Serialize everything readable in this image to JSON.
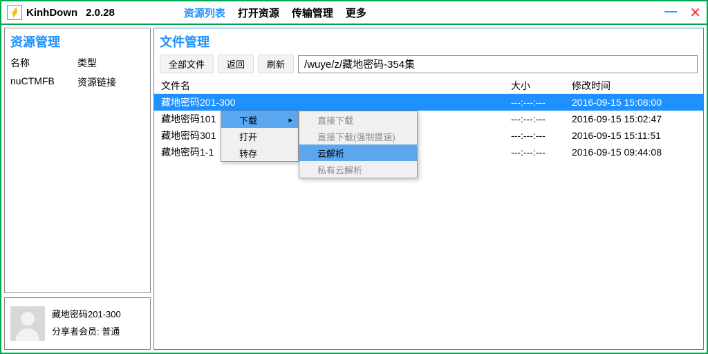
{
  "titlebar": {
    "app": "KinhDown",
    "version": "2.0.28",
    "tabs": {
      "t0": "资源列表",
      "t1": "打开资源",
      "t2": "传输管理",
      "t3": "更多"
    }
  },
  "sidebar": {
    "title": "资源管理",
    "head": {
      "c0": "名称",
      "c1": "类型"
    },
    "rows": [
      {
        "c0": "nuCTMFB",
        "c1": "资源链接"
      }
    ]
  },
  "sharer": {
    "name": "藏地密码201-300",
    "memberLabel": "分享者会员:",
    "memberValue": "普通"
  },
  "main": {
    "title": "文件管理",
    "btns": {
      "all": "全部文件",
      "back": "返回",
      "refresh": "刷新"
    },
    "path": "/wuye/z/藏地密码-354集",
    "head": {
      "name": "文件名",
      "size": "大小",
      "time": "修改时间"
    },
    "rows": [
      {
        "name": "藏地密码201-300",
        "size": "---:---:---",
        "time": "2016-09-15 15:08:00"
      },
      {
        "name": "藏地密码101-200",
        "size": "---:---:---",
        "time": "2016-09-15 15:02:47"
      },
      {
        "name": "藏地密码301-354",
        "size": "---:---:---",
        "time": "2016-09-15 15:11:51"
      },
      {
        "name": "藏地密码1-100",
        "size": "---:---:---",
        "time": "2016-09-15 09:44:08"
      }
    ],
    "rowsVisible": [
      {
        "name": "藏地密码201-300",
        "size": "---:---:---",
        "time": "2016-09-15 15:08:00"
      },
      {
        "name": "藏地密码101",
        "size": "---:---:---",
        "time": "2016-09-15 15:02:47"
      },
      {
        "name": "藏地密码301",
        "size": "---:---:---",
        "time": "2016-09-15 15:11:51"
      },
      {
        "name": "藏地密码1-1",
        "size": "---:---:---",
        "time": "2016-09-15 09:44:08"
      }
    ]
  },
  "ctx1": {
    "i0": "下载",
    "i1": "打开",
    "i2": "转存"
  },
  "ctx2": {
    "i0": "直接下载",
    "i1": "直接下载(强制提速)",
    "i2": "云解析",
    "i3": "私有云解析"
  }
}
